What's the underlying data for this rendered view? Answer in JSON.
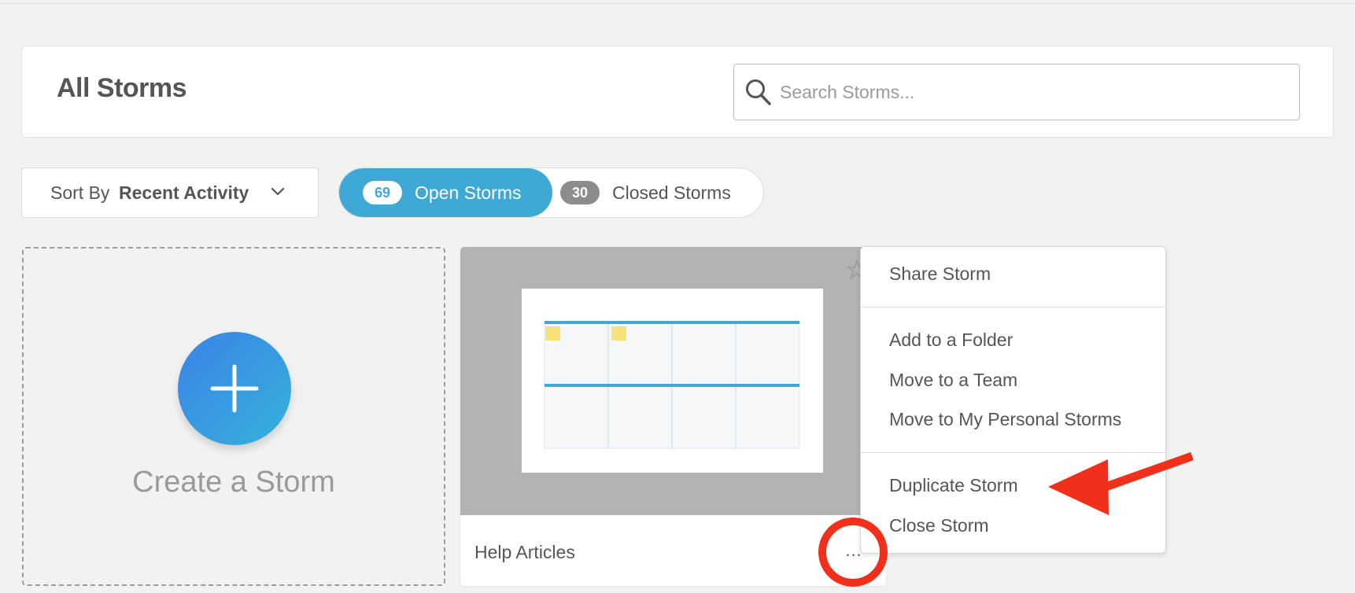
{
  "header": {
    "title": "All Storms",
    "search": {
      "placeholder": "Search Storms...",
      "value": ""
    }
  },
  "sort": {
    "label": "Sort By",
    "value": "Recent Activity"
  },
  "filters": {
    "open": {
      "count": "69",
      "label": "Open Storms"
    },
    "closed": {
      "count": "30",
      "label": "Closed Storms"
    }
  },
  "create_card": {
    "label": "Create a Storm"
  },
  "storm_card": {
    "name": "Help Articles",
    "more_label": "..."
  },
  "context_menu": {
    "items": [
      "Share Storm",
      "Add to a Folder",
      "Move to a Team",
      "Move to My Personal Storms",
      "Duplicate Storm",
      "Close Storm"
    ]
  },
  "colors": {
    "accent": "#3fa9d6",
    "annotation": "#f1301c",
    "sticky_note": "#f7e27a"
  },
  "icons": {
    "search": "search-icon",
    "sort_chevron": "chevron-down-icon",
    "create": "plus-icon",
    "favorite": "star-icon",
    "more": "more-icon"
  }
}
